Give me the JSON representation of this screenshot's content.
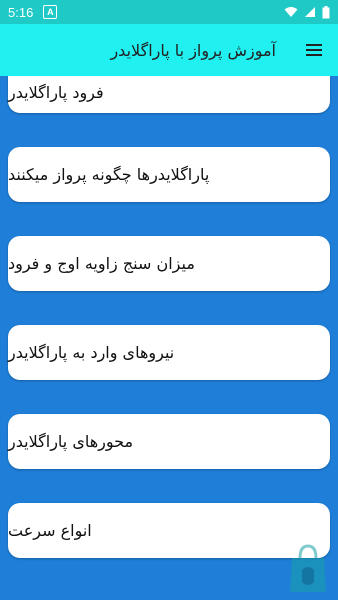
{
  "status_bar": {
    "time": "5:16",
    "notification_icon": "A"
  },
  "app_bar": {
    "title": "آموزش پرواز با پاراگلایدر"
  },
  "list": {
    "items": [
      {
        "label": "فرود پاراگلایدر"
      },
      {
        "label": "پاراگلایدرها چگونه پرواز میکنند"
      },
      {
        "label": "میزان سنج زاویه اوج و فرود"
      },
      {
        "label": "نیروهای وارد به پاراگلایدر"
      },
      {
        "label": "محورهای پاراگلایدر"
      },
      {
        "label": "انواع سرعت"
      }
    ]
  },
  "colors": {
    "status_bar": "#1ec9c6",
    "app_bar": "#20f0f0",
    "background": "#1e7ed8",
    "card": "#ffffff"
  }
}
